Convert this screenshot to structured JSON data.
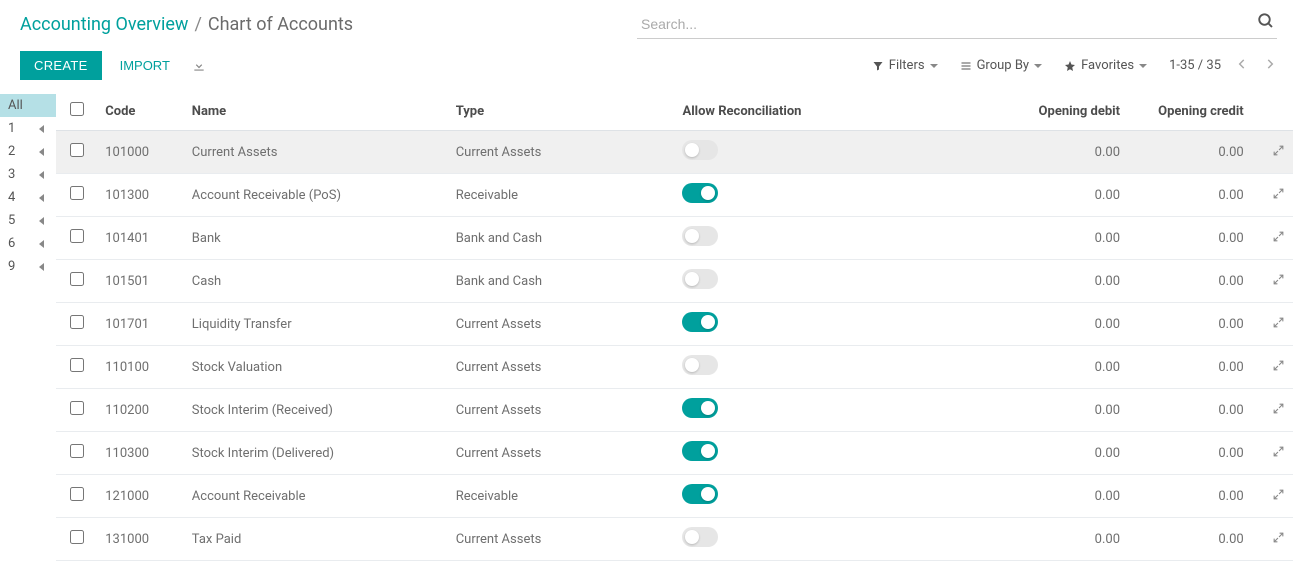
{
  "breadcrumb": {
    "parent": "Accounting Overview",
    "sep": "/",
    "current": "Chart of Accounts"
  },
  "search": {
    "placeholder": "Search..."
  },
  "buttons": {
    "create": "CREATE",
    "import": "IMPORT"
  },
  "filters": {
    "filters": "Filters",
    "group_by": "Group By",
    "favorites": "Favorites"
  },
  "pager": {
    "range": "1-35 / 35"
  },
  "alpha": [
    "All",
    "1",
    "2",
    "3",
    "4",
    "5",
    "6",
    "9"
  ],
  "columns": {
    "code": "Code",
    "name": "Name",
    "type": "Type",
    "recon": "Allow Reconciliation",
    "debit": "Opening debit",
    "credit": "Opening credit"
  },
  "rows": [
    {
      "code": "101000",
      "name": "Current Assets",
      "type": "Current Assets",
      "recon": false,
      "debit": "0.00",
      "credit": "0.00",
      "hl": true
    },
    {
      "code": "101300",
      "name": "Account Receivable (PoS)",
      "type": "Receivable",
      "recon": true,
      "debit": "0.00",
      "credit": "0.00"
    },
    {
      "code": "101401",
      "name": "Bank",
      "type": "Bank and Cash",
      "recon": false,
      "debit": "0.00",
      "credit": "0.00"
    },
    {
      "code": "101501",
      "name": "Cash",
      "type": "Bank and Cash",
      "recon": false,
      "debit": "0.00",
      "credit": "0.00"
    },
    {
      "code": "101701",
      "name": "Liquidity Transfer",
      "type": "Current Assets",
      "recon": true,
      "debit": "0.00",
      "credit": "0.00"
    },
    {
      "code": "110100",
      "name": "Stock Valuation",
      "type": "Current Assets",
      "recon": false,
      "debit": "0.00",
      "credit": "0.00"
    },
    {
      "code": "110200",
      "name": "Stock Interim (Received)",
      "type": "Current Assets",
      "recon": true,
      "debit": "0.00",
      "credit": "0.00"
    },
    {
      "code": "110300",
      "name": "Stock Interim (Delivered)",
      "type": "Current Assets",
      "recon": true,
      "debit": "0.00",
      "credit": "0.00"
    },
    {
      "code": "121000",
      "name": "Account Receivable",
      "type": "Receivable",
      "recon": true,
      "debit": "0.00",
      "credit": "0.00"
    },
    {
      "code": "131000",
      "name": "Tax Paid",
      "type": "Current Assets",
      "recon": false,
      "debit": "0.00",
      "credit": "0.00"
    }
  ]
}
